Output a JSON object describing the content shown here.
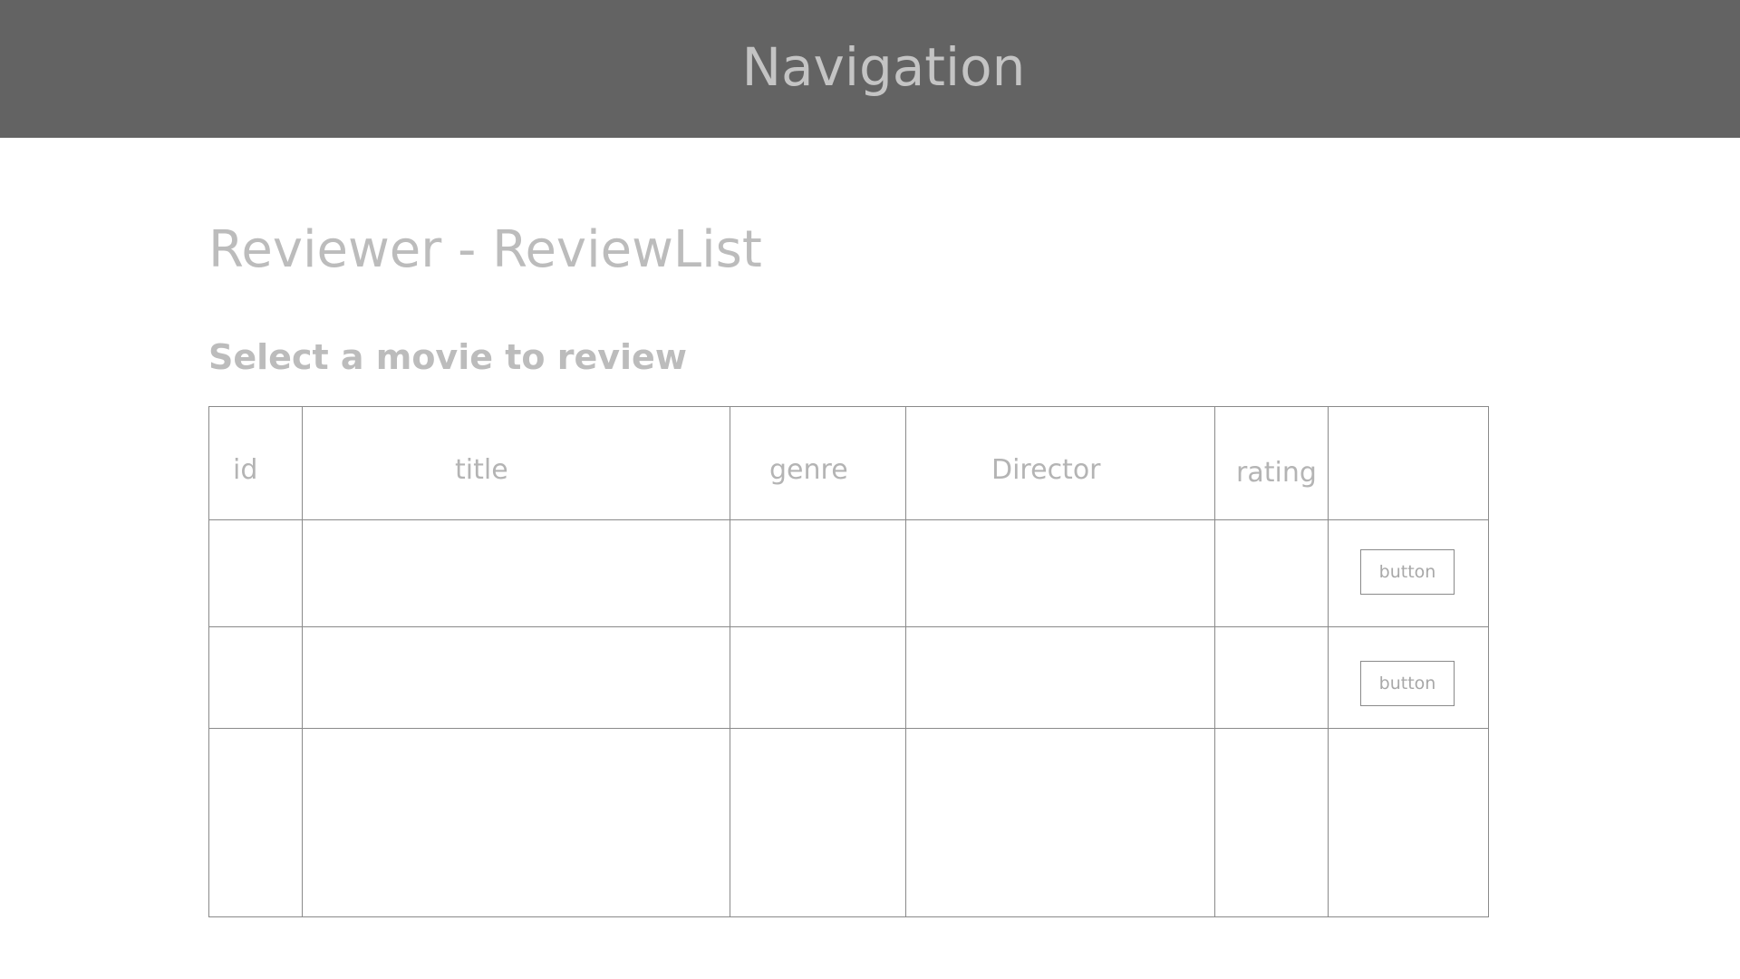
{
  "nav": {
    "title": "Navigation"
  },
  "page": {
    "title": "Reviewer - ReviewList",
    "subtitle": "Select a movie to review"
  },
  "table": {
    "columns": [
      "id",
      "title",
      "genre",
      "Director",
      "rating",
      ""
    ],
    "rows": [
      {
        "id": "",
        "title": "",
        "genre": "",
        "director": "",
        "rating": "",
        "action_label": "button"
      },
      {
        "id": "",
        "title": "",
        "genre": "",
        "director": "",
        "rating": "",
        "action_label": "button"
      },
      {
        "id": "",
        "title": "",
        "genre": "",
        "director": "",
        "rating": "",
        "action_label": ""
      }
    ]
  },
  "colors": {
    "nav_background": "#636363",
    "text_light": "#bcbcbc",
    "grid_line": "#8a8a8a"
  }
}
